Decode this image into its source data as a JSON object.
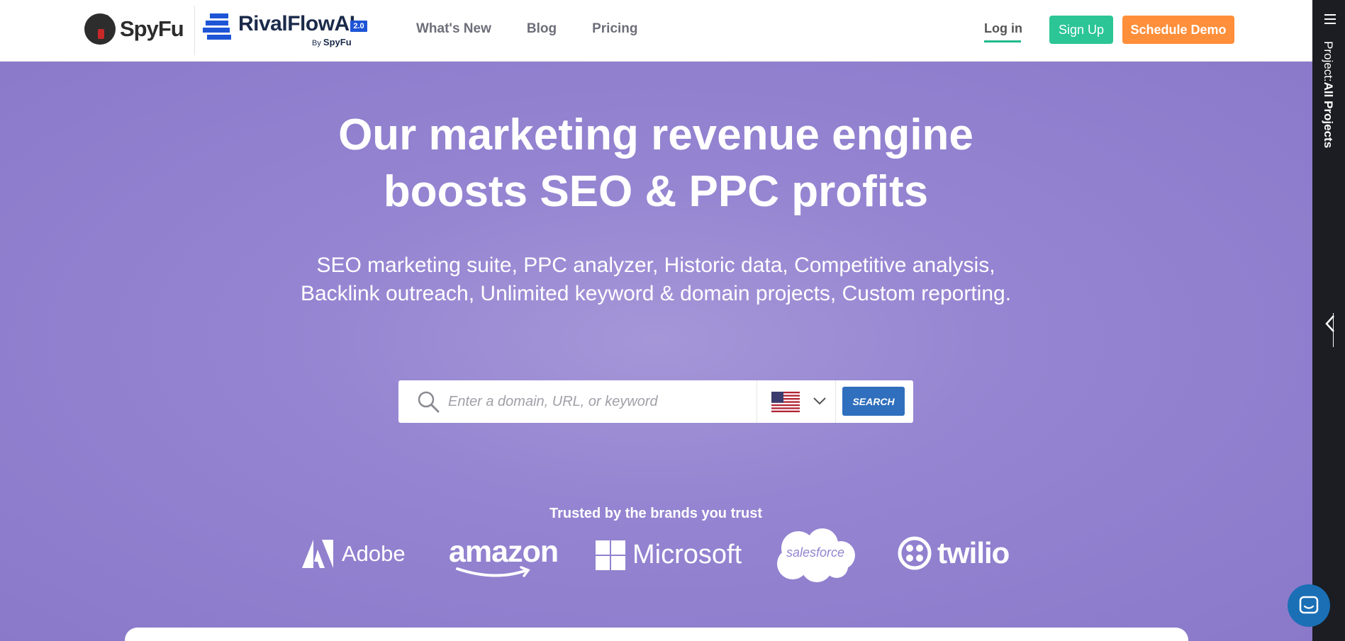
{
  "header": {
    "spyfu_logo": "SpyFu",
    "rivalflow_logo": "RivalFlowAI",
    "rivalflow_version": "2.0",
    "rivalflow_by": "By",
    "rivalflow_by_brand": "SpyFu",
    "nav": [
      "What's New",
      "Blog",
      "Pricing"
    ],
    "login": "Log in",
    "signup": "Sign Up",
    "schedule_demo": "Schedule Demo"
  },
  "sidebar": {
    "project_prefix": "Project:",
    "project_value": "All Projects"
  },
  "hero": {
    "headline_line1": "Our marketing revenue engine",
    "headline_line2": "boosts SEO & PPC profits",
    "subhead": "SEO marketing suite, PPC analyzer, Historic data, Competitive analysis, Backlink outreach, Unlimited keyword & domain projects, Custom reporting."
  },
  "search": {
    "placeholder": "Enter a domain, URL, or keyword",
    "value": "",
    "country": "flag-us-icon",
    "button": "SEARCH"
  },
  "trusted": {
    "title": "Trusted by the brands you trust",
    "brands": [
      "Adobe",
      "amazon",
      "Microsoft",
      "salesforce",
      "twilio"
    ]
  },
  "colors": {
    "hero_bg": "#8e7fcb",
    "signup": "#2cc596",
    "demo": "#ff8f3a",
    "search_button": "#2f6fbd",
    "sidebar": "#1b1d22",
    "chat": "#1a6fb5"
  }
}
